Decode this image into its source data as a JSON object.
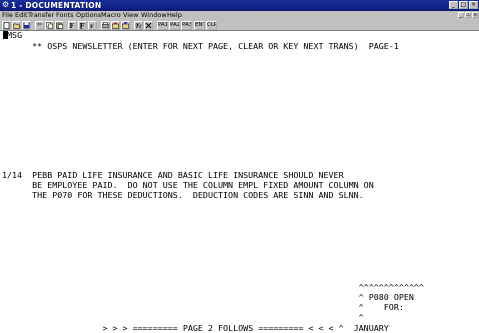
{
  "window": {
    "title": "1 - DOCUMENTATION",
    "app_icon": "terminal-app-icon",
    "controls": {
      "minimize": "_",
      "maximize": "□",
      "close": "×"
    }
  },
  "menu": {
    "items": [
      "File",
      "Edit",
      "Transfer",
      "Fonts",
      "Options",
      "Macro",
      "View",
      "Window",
      "Help"
    ]
  },
  "toolbar": {
    "icons": [
      "new-session-icon",
      "open-session-icon",
      "save-icon",
      "cut-icon",
      "copy-icon",
      "paste-icon",
      "font-size-icon",
      "font-larger-icon",
      "font-smaller-icon",
      "print-icon",
      "transfer-send-icon",
      "transfer-receive-icon",
      "help-icon",
      "stop-icon"
    ],
    "keys": [
      "PA1",
      "PA2",
      "PA3",
      "ENT",
      "CLR"
    ]
  },
  "terminal": {
    "lines": [
      " MSG",
      "      ** OSPS NEWSLETTER (ENTER FOR NEXT PAGE, CLEAR OR KEY NEXT TRANS)  PAGE-1",
      "1/14  PEBB PAID LIFE INSURANCE AND BASIC LIFE INSURANCE SHOULD NEVER",
      "      BE EMPLOYEE PAID.  DO NOT USE THE COLUMN EMPL FIXED AMOUNT COLUMN ON",
      "      THE P070 FOR THESE DEDUCTIONS.  DEDUCTION CODES ARE SINN AND SLNN.",
      "                                                                       ^^^^^^^^^^^^^",
      "                                                                       ^ P080 OPEN",
      "                                                                       ^    FOR:",
      "                                                                       ^",
      "                    > > > ========= PAGE 2 FOLLOWS ========= < < < ^  JANUARY"
    ]
  }
}
